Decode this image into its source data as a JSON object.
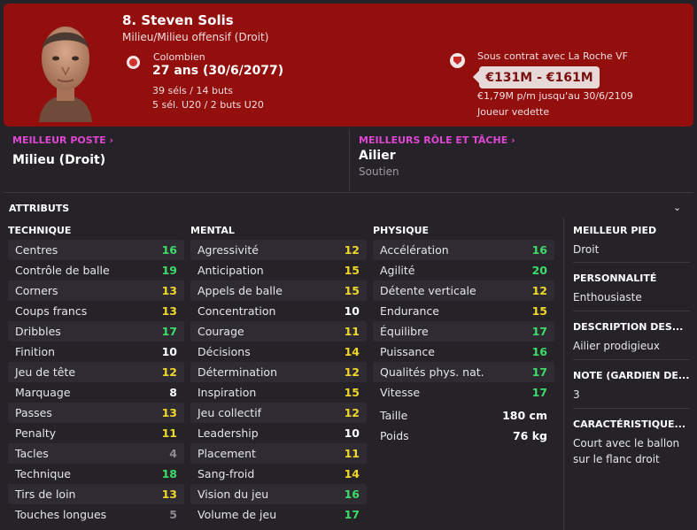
{
  "header": {
    "name": "8. Steven Solis",
    "position": "Milieu/Milieu offensif (Droit)",
    "nationality": "Colombien",
    "age": "27 ans (30/6/2077)",
    "caps": "39 séls / 14 buts",
    "u20": "5 sél. U20 / 2 buts U20",
    "contract": "Sous contrat avec La Roche VF",
    "value": "€131M - €161M",
    "wage": "€1,79M p/m jusqu'au 30/6/2109",
    "status": "Joueur vedette"
  },
  "best_position": {
    "link": "MEILLEUR POSTE",
    "value": "Milieu (Droit)"
  },
  "best_role": {
    "link": "MEILLEURS RÔLE ET TÂCHE",
    "value": "Ailier",
    "duty": "Soutien"
  },
  "attributes_title": "ATTRIBUTS",
  "technique": {
    "title": "TECHNIQUE",
    "rows": [
      {
        "label": "Centres",
        "value": "16",
        "tone": "green"
      },
      {
        "label": "Contrôle de balle",
        "value": "19",
        "tone": "green"
      },
      {
        "label": "Corners",
        "value": "13",
        "tone": "yellow"
      },
      {
        "label": "Coups francs",
        "value": "13",
        "tone": "yellow"
      },
      {
        "label": "Dribbles",
        "value": "17",
        "tone": "green"
      },
      {
        "label": "Finition",
        "value": "10",
        "tone": "white"
      },
      {
        "label": "Jeu de tête",
        "value": "12",
        "tone": "yellow"
      },
      {
        "label": "Marquage",
        "value": "8",
        "tone": "white"
      },
      {
        "label": "Passes",
        "value": "13",
        "tone": "yellow"
      },
      {
        "label": "Penalty",
        "value": "11",
        "tone": "yellow"
      },
      {
        "label": "Tacles",
        "value": "4",
        "tone": "grey"
      },
      {
        "label": "Technique",
        "value": "18",
        "tone": "green"
      },
      {
        "label": "Tirs de loin",
        "value": "13",
        "tone": "yellow"
      },
      {
        "label": "Touches longues",
        "value": "5",
        "tone": "grey"
      }
    ]
  },
  "mental": {
    "title": "MENTAL",
    "rows": [
      {
        "label": "Agressivité",
        "value": "12",
        "tone": "yellow"
      },
      {
        "label": "Anticipation",
        "value": "15",
        "tone": "yellow"
      },
      {
        "label": "Appels de balle",
        "value": "15",
        "tone": "yellow"
      },
      {
        "label": "Concentration",
        "value": "10",
        "tone": "white"
      },
      {
        "label": "Courage",
        "value": "11",
        "tone": "yellow"
      },
      {
        "label": "Décisions",
        "value": "14",
        "tone": "yellow"
      },
      {
        "label": "Détermination",
        "value": "12",
        "tone": "yellow"
      },
      {
        "label": "Inspiration",
        "value": "15",
        "tone": "yellow"
      },
      {
        "label": "Jeu collectif",
        "value": "12",
        "tone": "yellow"
      },
      {
        "label": "Leadership",
        "value": "10",
        "tone": "white"
      },
      {
        "label": "Placement",
        "value": "11",
        "tone": "yellow"
      },
      {
        "label": "Sang-froid",
        "value": "14",
        "tone": "yellow"
      },
      {
        "label": "Vision du jeu",
        "value": "16",
        "tone": "green"
      },
      {
        "label": "Volume de jeu",
        "value": "17",
        "tone": "green"
      }
    ]
  },
  "physique": {
    "title": "PHYSIQUE",
    "rows": [
      {
        "label": "Accélération",
        "value": "16",
        "tone": "green"
      },
      {
        "label": "Agilité",
        "value": "20",
        "tone": "green"
      },
      {
        "label": "Détente verticale",
        "value": "12",
        "tone": "yellow"
      },
      {
        "label": "Endurance",
        "value": "15",
        "tone": "yellow"
      },
      {
        "label": "Équilibre",
        "value": "17",
        "tone": "green"
      },
      {
        "label": "Puissance",
        "value": "16",
        "tone": "green"
      },
      {
        "label": "Qualités phys. nat.",
        "value": "17",
        "tone": "green"
      },
      {
        "label": "Vitesse",
        "value": "17",
        "tone": "green"
      }
    ],
    "height_label": "Taille",
    "height_value": "180 cm",
    "weight_label": "Poids",
    "weight_value": "76 kg"
  },
  "side": {
    "best_foot_title": "MEILLEUR PIED",
    "best_foot": "Droit",
    "personality_title": "PERSONNALITÉ",
    "personality": "Enthousiaste",
    "description_title": "DESCRIPTION DES...",
    "description": "Ailier prodigieux",
    "gk_title": "NOTE (GARDIEN DE...",
    "gk_value": "3",
    "traits_title": "CARACTÉRISTIQUE...",
    "traits": "Court avec le ballon sur le flanc droit"
  },
  "icons": {
    "chevron": "chevron-down-icon",
    "nation": "colombia-flag-icon",
    "club": "club-badge-icon",
    "link_arrow": "chevron-right-icon"
  },
  "colors": {
    "header_bg": "#920f0e",
    "accent_link": "#e046d4",
    "green": "#3ddc6a",
    "yellow": "#f0d62a",
    "grey": "#8d8a93"
  }
}
